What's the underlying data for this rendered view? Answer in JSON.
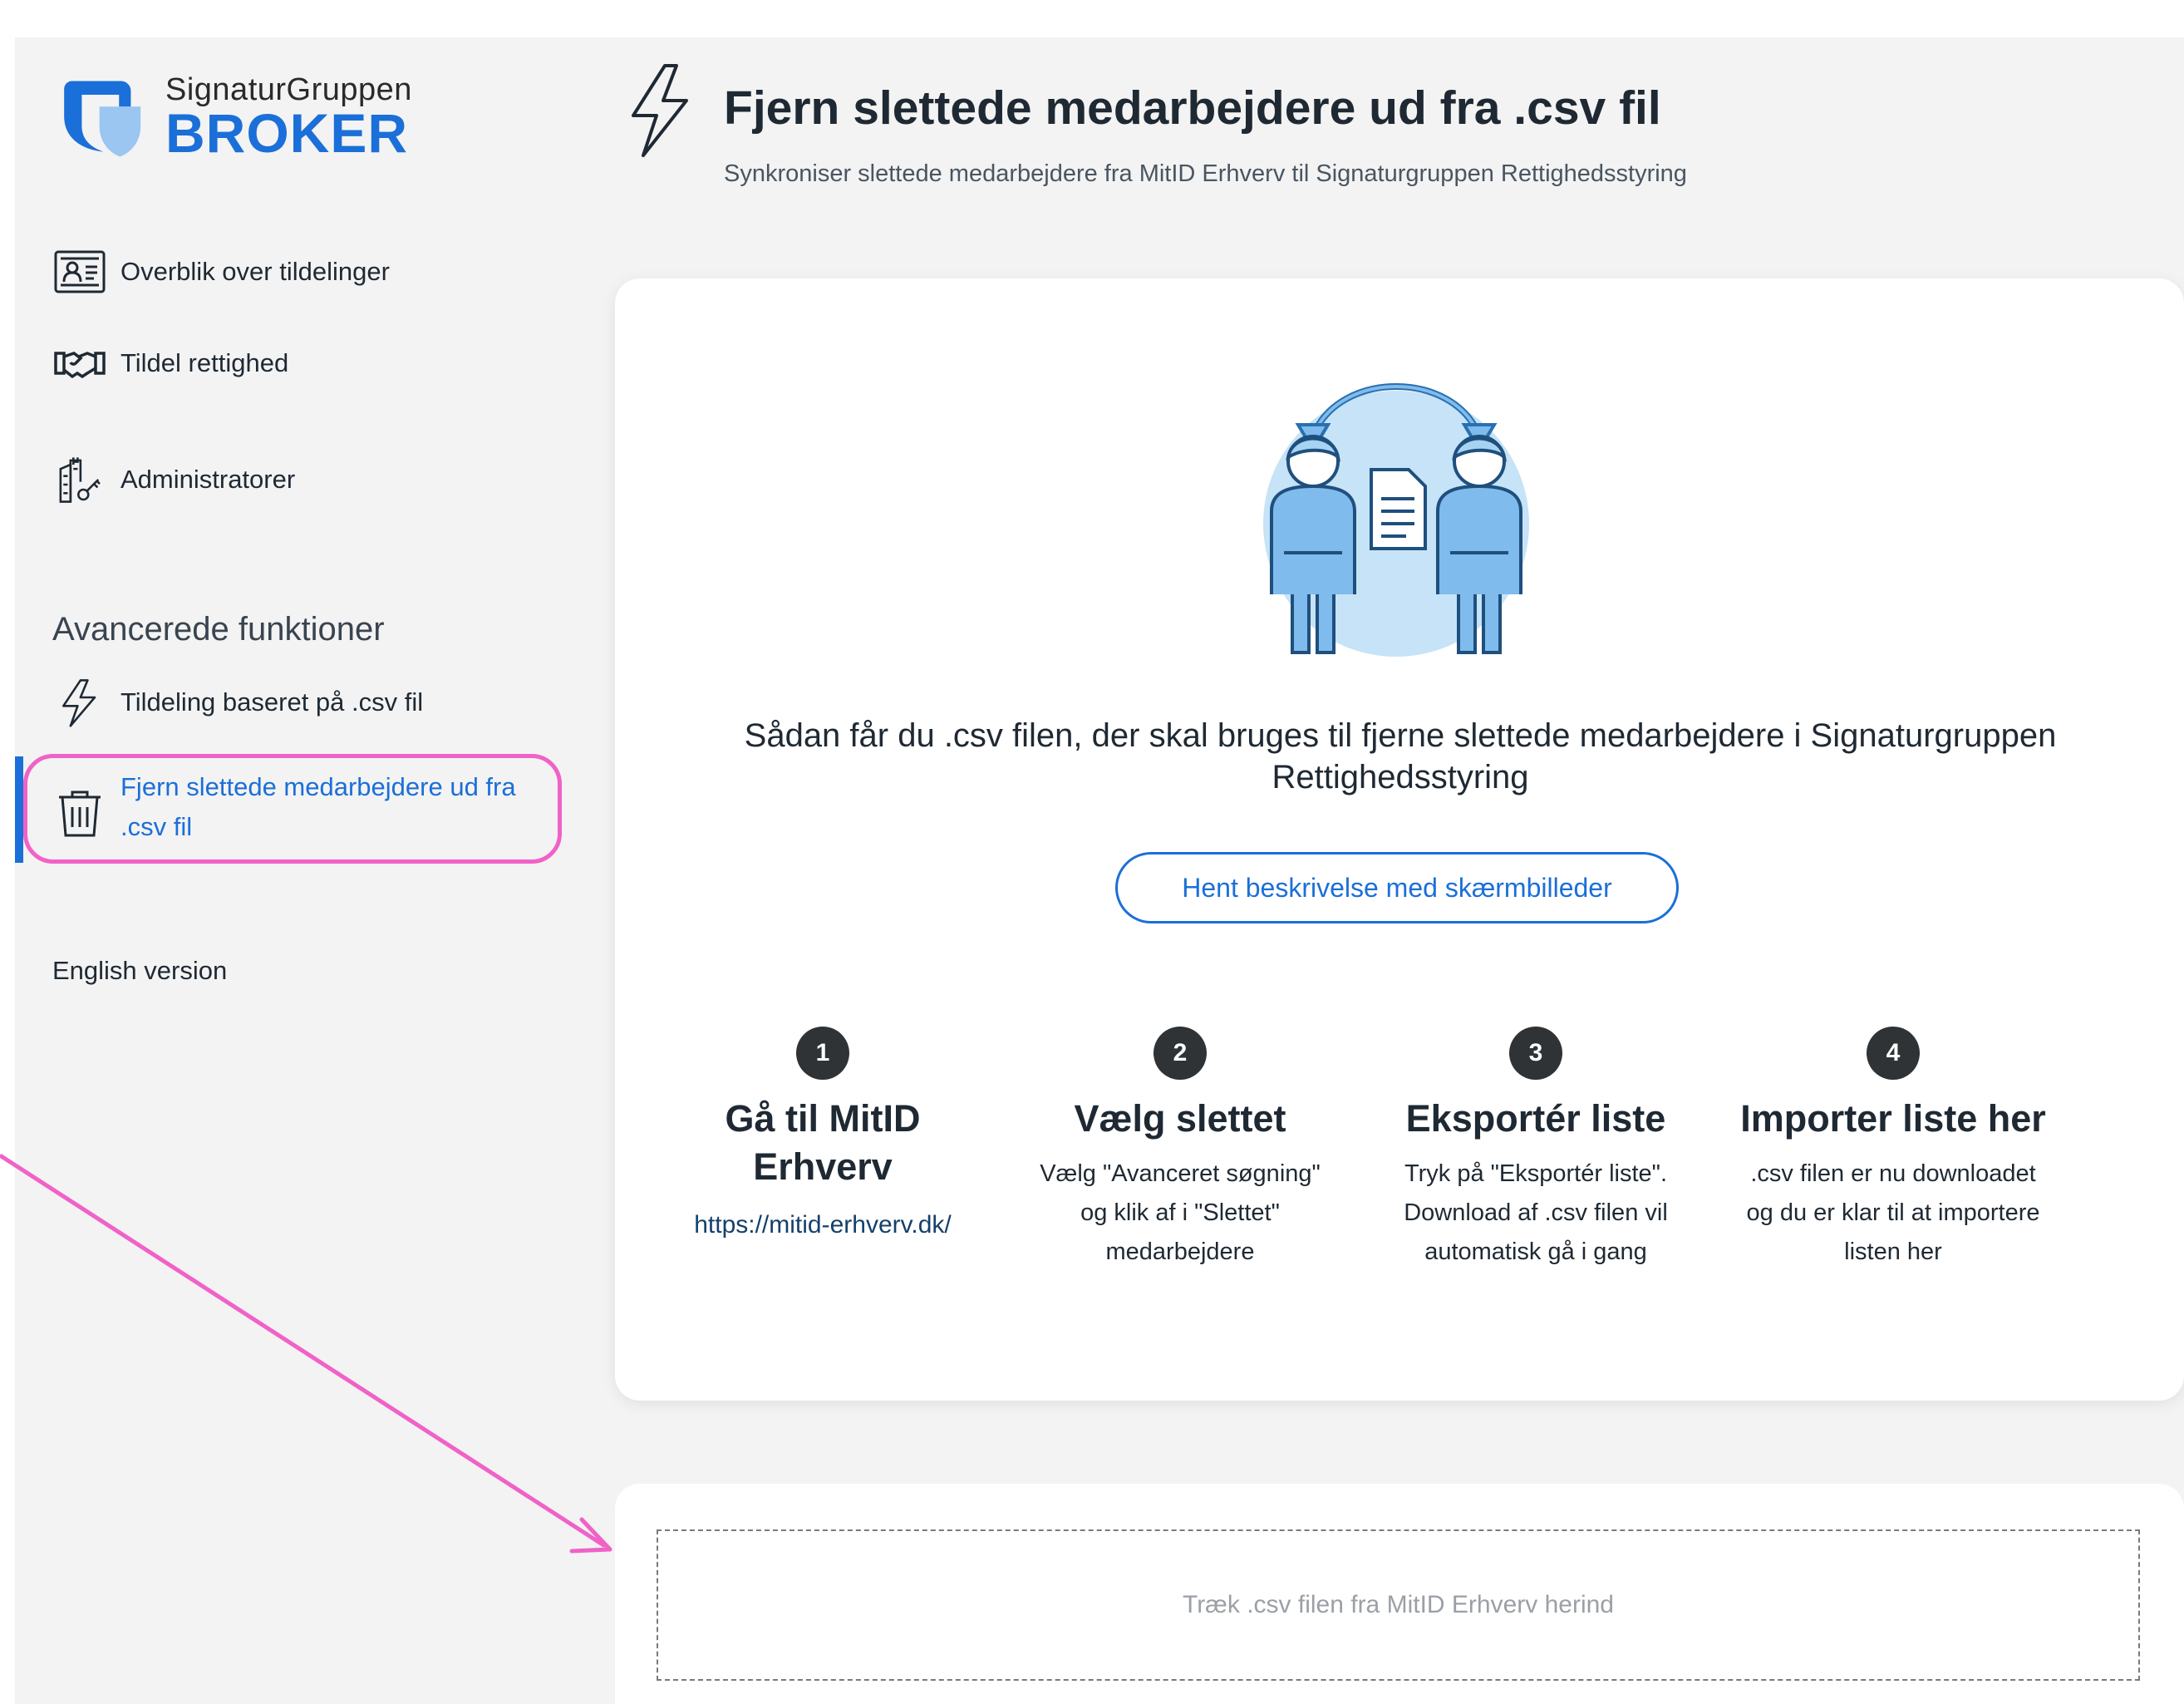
{
  "brand": {
    "logo_sub": "SignaturGruppen",
    "logo_main": "BROKER",
    "accent_color": "#1b6fd8"
  },
  "sidebar": {
    "items": [
      {
        "label": "Overblik over tildelinger",
        "icon": "id-card-icon"
      },
      {
        "label": "Tildel rettighed",
        "icon": "handshake-icon"
      },
      {
        "label": "Administratorer",
        "icon": "building-key-icon"
      }
    ],
    "section_title": "Avancerede funktioner",
    "advanced_items": [
      {
        "label": "Tildeling baseret på .csv fil",
        "icon": "lightning-icon"
      },
      {
        "label": "Fjern slettede medarbejdere ud fra .csv fil",
        "icon": "trash-icon",
        "active": true
      }
    ],
    "english_label": "English version"
  },
  "header": {
    "title": "Fjern slettede medarbejdere ud fra .csv fil",
    "subtitle": "Synkroniser slettede medarbejdere fra MitID Erhverv til Signaturgruppen Rettighedsstyring",
    "icon": "lightning-icon"
  },
  "card": {
    "heading": "Sådan får du .csv filen, der skal bruges til fjerne slettede medarbejdere i Signaturgruppen Rettighedsstyring",
    "button_label": "Hent beskrivelse med skærmbilleder",
    "steps": [
      {
        "number": "1",
        "title": "Gå til MitID Erhverv",
        "link": "https://mitid-erhverv.dk/"
      },
      {
        "number": "2",
        "title": "Vælg slettet",
        "desc": "Vælg \"Avanceret søgning\" og klik af i \"Slettet\" medarbejdere"
      },
      {
        "number": "3",
        "title": "Eksportér liste",
        "desc": "Tryk på \"Eksportér liste\". Download af .csv filen vil automatisk gå i gang"
      },
      {
        "number": "4",
        "title": "Importer liste her",
        "desc": ".csv filen er nu downloadet og du er klar til at importere listen her"
      }
    ]
  },
  "dropzone": {
    "placeholder": "Træk .csv filen fra MitID Erhverv herind"
  },
  "annotation": {
    "highlight_color": "#f062c8"
  }
}
